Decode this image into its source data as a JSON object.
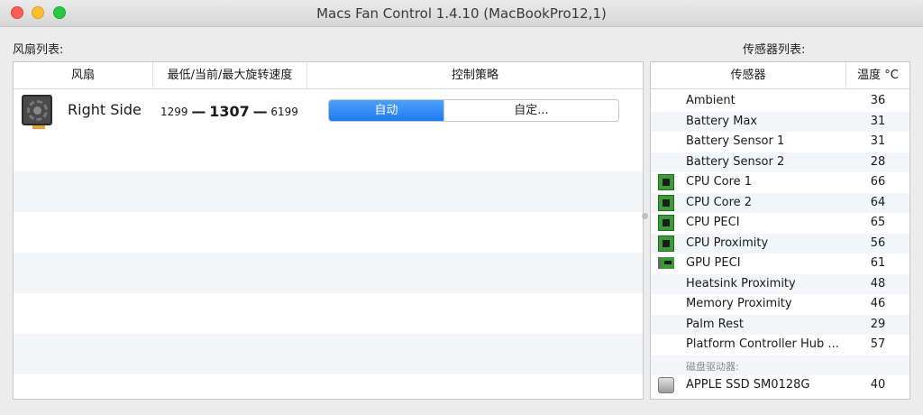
{
  "window": {
    "title": "Macs Fan Control 1.4.10 (MacBookPro12,1)"
  },
  "fans": {
    "section_label": "风扇列表:",
    "headers": {
      "fan": "风扇",
      "speed": "最低/当前/最大旋转速度",
      "control": "控制策略"
    },
    "rows": [
      {
        "name": "Right Side",
        "min": "1299",
        "current": "1307",
        "max": "6199",
        "separator": "—",
        "auto_label": "自动",
        "custom_label": "自定..."
      }
    ]
  },
  "sensors": {
    "section_label": "传感器列表:",
    "headers": {
      "sensor": "传感器",
      "temp": "温度 °C"
    },
    "rows": [
      {
        "name": "Ambient",
        "value": "36",
        "icon": "none"
      },
      {
        "name": "Battery Max",
        "value": "31",
        "icon": "none"
      },
      {
        "name": "Battery Sensor 1",
        "value": "31",
        "icon": "none"
      },
      {
        "name": "Battery Sensor 2",
        "value": "28",
        "icon": "none"
      },
      {
        "name": "CPU Core 1",
        "value": "66",
        "icon": "cpu-chip-icon"
      },
      {
        "name": "CPU Core 2",
        "value": "64",
        "icon": "cpu-chip-icon"
      },
      {
        "name": "CPU PECI",
        "value": "65",
        "icon": "cpu-chip-icon"
      },
      {
        "name": "CPU Proximity",
        "value": "56",
        "icon": "cpu-chip-icon"
      },
      {
        "name": "GPU PECI",
        "value": "61",
        "icon": "gpu-card-icon"
      },
      {
        "name": "Heatsink Proximity",
        "value": "48",
        "icon": "none"
      },
      {
        "name": "Memory Proximity",
        "value": "46",
        "icon": "none"
      },
      {
        "name": "Palm Rest",
        "value": "29",
        "icon": "none"
      },
      {
        "name": "Platform Controller Hub ...",
        "value": "57",
        "icon": "none"
      }
    ],
    "disk_group_label": "磁盘驱动器:",
    "disks": [
      {
        "name": "APPLE SSD SM0128G",
        "value": "40",
        "icon": "disk-drive-icon"
      }
    ]
  }
}
